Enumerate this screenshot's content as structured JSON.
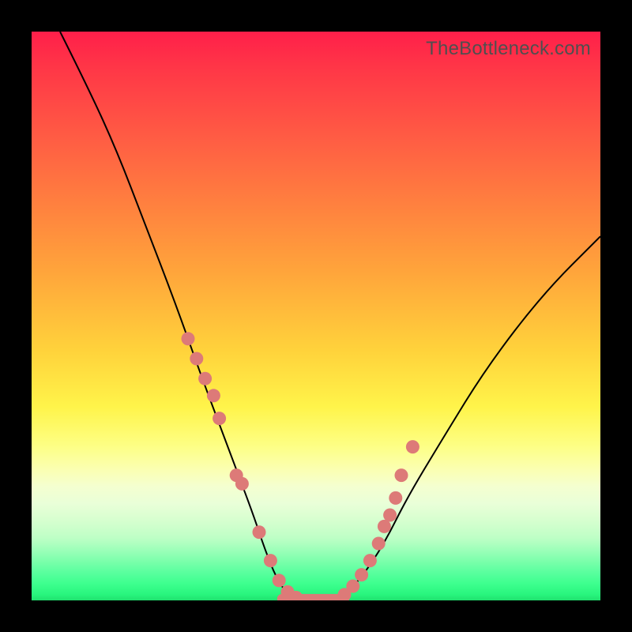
{
  "watermark": "TheBottleneck.com",
  "chart_data": {
    "type": "line",
    "title": "",
    "xlabel": "",
    "ylabel": "",
    "xlim": [
      0,
      100
    ],
    "ylim": [
      0,
      100
    ],
    "series": [
      {
        "name": "bottleneck-curve",
        "x": [
          5,
          10,
          15,
          20,
          25,
          30,
          33,
          36,
          39,
          41,
          43,
          45,
          48,
          52,
          55,
          58,
          62,
          66,
          72,
          80,
          90,
          100
        ],
        "y": [
          100,
          90,
          79,
          66,
          53,
          39,
          31,
          23,
          15,
          9,
          4,
          1,
          0,
          0,
          1,
          4,
          10,
          18,
          28,
          41,
          54,
          64
        ]
      }
    ],
    "markers": {
      "name": "highlight-dots",
      "x": [
        27.5,
        29,
        30.5,
        32,
        33,
        36,
        37,
        40,
        42,
        43.5,
        45,
        46.5,
        55,
        56.5,
        58,
        59.5,
        61,
        62,
        63,
        64,
        65,
        67
      ],
      "y": [
        46,
        42.5,
        39,
        36,
        32,
        22,
        20.5,
        12,
        7,
        3.5,
        1.5,
        0.5,
        1,
        2.5,
        4.5,
        7,
        10,
        13,
        15,
        18,
        22,
        27
      ]
    },
    "flat_segment": {
      "x0": 44,
      "x1": 55,
      "y": 0.3
    },
    "background": "red-yellow-green-gradient",
    "grid": false,
    "legend": false
  }
}
